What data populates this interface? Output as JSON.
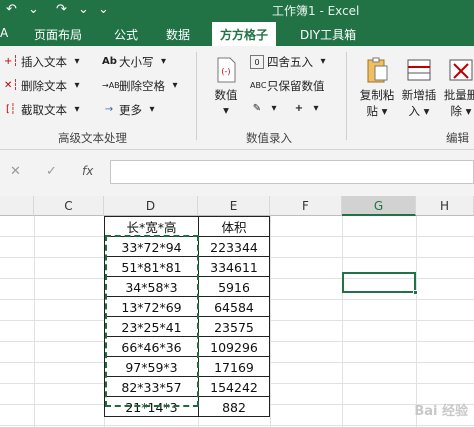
{
  "window": {
    "title": "工作簿1 - Excel"
  },
  "ribbon_tabs": [
    {
      "label": "А"
    },
    {
      "label": "页面布局"
    },
    {
      "label": "公式"
    },
    {
      "label": "数据"
    },
    {
      "label": "方方格子"
    },
    {
      "label": "DIY工具箱"
    }
  ],
  "ribbon": {
    "text_group": {
      "label": "高级文本处理",
      "buttons": [
        "插入文本",
        "删除文本",
        "截取文本",
        "大小写",
        "删除空格",
        "更多"
      ]
    },
    "numeric_group": {
      "label": "数值录入",
      "big_button": "数值",
      "buttons": [
        "四舍五入",
        "只保留数值"
      ]
    },
    "edit_group": {
      "label": "编辑",
      "buttons": [
        "复制粘贴",
        "新增插入",
        "批量删除"
      ],
      "button_lines": [
        [
          "复制粘",
          "贴"
        ],
        [
          "新增插",
          "入"
        ],
        [
          "批量删",
          "除"
        ]
      ]
    }
  },
  "formula_bar": {
    "cancel_symbol": "✕",
    "enter_symbol": "✓",
    "fx_label": "fx",
    "content": ""
  },
  "columns": [
    "C",
    "D",
    "E",
    "F",
    "G",
    "H"
  ],
  "table": {
    "headers": [
      "长*宽*高",
      "体积"
    ],
    "rows": [
      [
        "33*72*94",
        "223344"
      ],
      [
        "51*81*81",
        "334611"
      ],
      [
        "34*58*3",
        "5916"
      ],
      [
        "13*72*69",
        "64584"
      ],
      [
        "23*25*41",
        "23575"
      ],
      [
        "66*46*36",
        "109296"
      ],
      [
        "97*59*3",
        "17169"
      ],
      [
        "82*33*57",
        "154242"
      ],
      [
        "21*14*3",
        "882"
      ]
    ]
  },
  "selected_column": "G",
  "watermark": "Bai 经验"
}
